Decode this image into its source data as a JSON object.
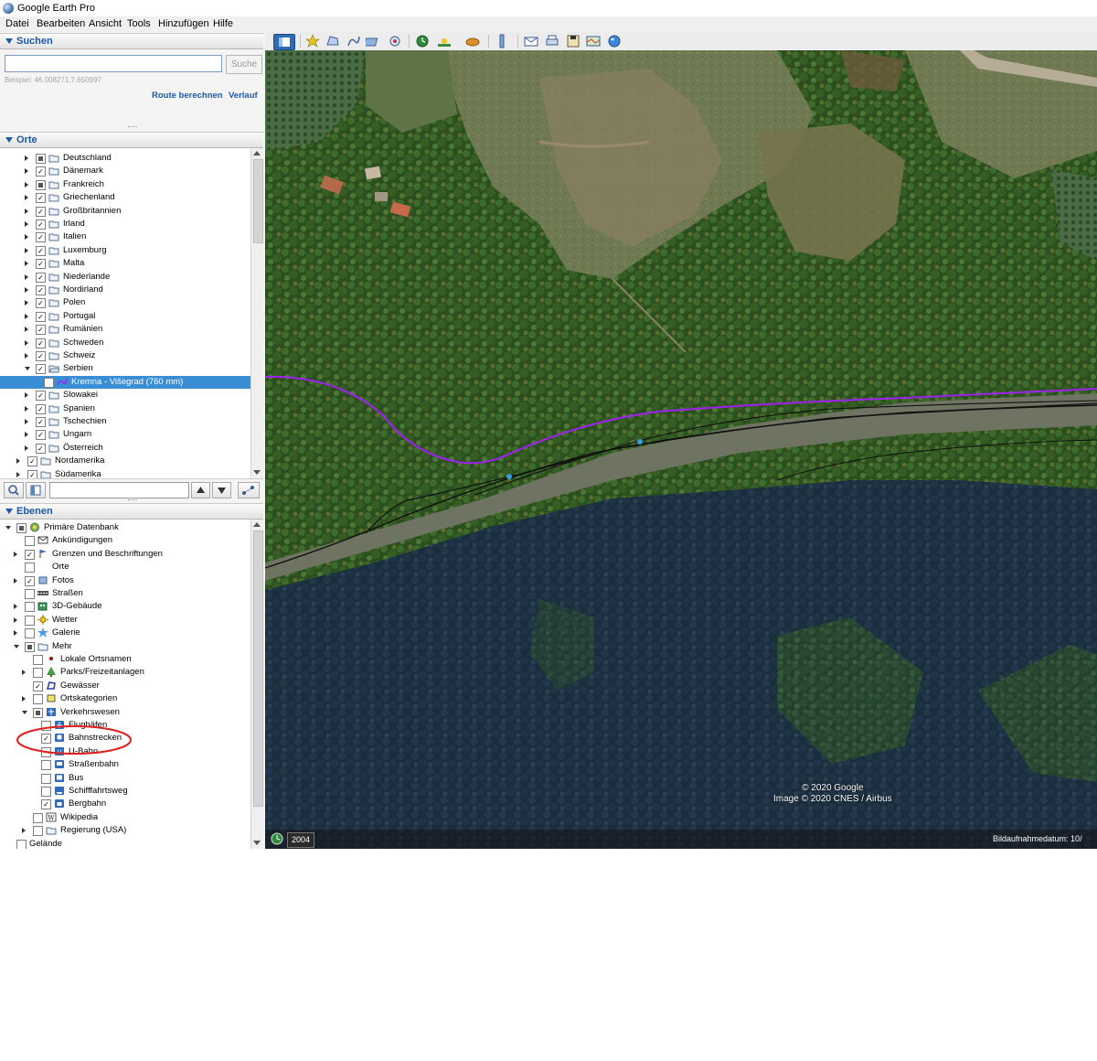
{
  "window": {
    "title": "Google Earth Pro"
  },
  "menu": [
    "Datei",
    "Bearbeiten",
    "Ansicht",
    "Tools",
    "Hinzufügen",
    "Hilfe"
  ],
  "search": {
    "header": "Suchen",
    "input_value": "",
    "button": "Suche",
    "example": "Beispiel: 46.008271,7.650997",
    "route_link": "Route berechnen",
    "history_link": "Verlauf"
  },
  "places": {
    "header": "Orte",
    "items": [
      {
        "label": "Deutschland",
        "depth": 3,
        "checked": "partial",
        "expanded": false,
        "icon": "folder-icon"
      },
      {
        "label": "Dänemark",
        "depth": 3,
        "checked": true,
        "expanded": false,
        "icon": "folder-icon"
      },
      {
        "label": "Frankreich",
        "depth": 3,
        "checked": "partial",
        "expanded": false,
        "icon": "folder-icon"
      },
      {
        "label": "Griechenland",
        "depth": 3,
        "checked": true,
        "expanded": false,
        "icon": "folder-icon"
      },
      {
        "label": "Großbritannien",
        "depth": 3,
        "checked": true,
        "expanded": false,
        "icon": "folder-icon"
      },
      {
        "label": "Irland",
        "depth": 3,
        "checked": true,
        "expanded": false,
        "icon": "folder-icon"
      },
      {
        "label": "Italien",
        "depth": 3,
        "checked": true,
        "expanded": false,
        "icon": "folder-icon"
      },
      {
        "label": "Luxemburg",
        "depth": 3,
        "checked": true,
        "expanded": false,
        "icon": "folder-icon"
      },
      {
        "label": "Malta",
        "depth": 3,
        "checked": true,
        "expanded": false,
        "icon": "folder-icon"
      },
      {
        "label": "Niederlande",
        "depth": 3,
        "checked": true,
        "expanded": false,
        "icon": "folder-icon"
      },
      {
        "label": "Nordirland",
        "depth": 3,
        "checked": true,
        "expanded": false,
        "icon": "folder-icon"
      },
      {
        "label": "Polen",
        "depth": 3,
        "checked": true,
        "expanded": false,
        "icon": "folder-icon"
      },
      {
        "label": "Portugal",
        "depth": 3,
        "checked": true,
        "expanded": false,
        "icon": "folder-icon"
      },
      {
        "label": "Rumänien",
        "depth": 3,
        "checked": true,
        "expanded": false,
        "icon": "folder-icon"
      },
      {
        "label": "Schweden",
        "depth": 3,
        "checked": true,
        "expanded": false,
        "icon": "folder-icon"
      },
      {
        "label": "Schweiz",
        "depth": 3,
        "checked": true,
        "expanded": false,
        "icon": "folder-icon"
      },
      {
        "label": "Serbien",
        "depth": 3,
        "checked": true,
        "expanded": true,
        "icon": "folder-open-icon"
      },
      {
        "label": "Kremna - Višegrad (760 mm)",
        "depth": 4,
        "checked": true,
        "expanded": null,
        "icon": "path-icon",
        "selected": true
      },
      {
        "label": "Slowakei",
        "depth": 3,
        "checked": true,
        "expanded": false,
        "icon": "folder-icon"
      },
      {
        "label": "Spanien",
        "depth": 3,
        "checked": true,
        "expanded": false,
        "icon": "folder-icon"
      },
      {
        "label": "Tschechien",
        "depth": 3,
        "checked": true,
        "expanded": false,
        "icon": "folder-icon"
      },
      {
        "label": "Ungarn",
        "depth": 3,
        "checked": true,
        "expanded": false,
        "icon": "folder-icon"
      },
      {
        "label": "Österreich",
        "depth": 3,
        "checked": true,
        "expanded": false,
        "icon": "folder-icon"
      },
      {
        "label": "Nordamerika",
        "depth": 2,
        "checked": true,
        "expanded": false,
        "icon": "folder-icon"
      },
      {
        "label": "Südamerika",
        "depth": 2,
        "checked": true,
        "expanded": false,
        "icon": "folder-icon"
      }
    ]
  },
  "layers": {
    "header": "Ebenen",
    "items": [
      {
        "label": "Primäre Datenbank",
        "depth": 0,
        "checked": "partial",
        "expanded": true,
        "icon": "database-icon"
      },
      {
        "label": "Ankündigungen",
        "depth": 1,
        "checked": false,
        "expanded": null,
        "icon": "envelope-icon"
      },
      {
        "label": "Grenzen und Beschriftungen",
        "depth": 1,
        "checked": true,
        "expanded": false,
        "icon": "flag-icon"
      },
      {
        "label": "Orte",
        "depth": 1,
        "checked": false,
        "expanded": null,
        "icon": "place-icon"
      },
      {
        "label": "Fotos",
        "depth": 1,
        "checked": true,
        "expanded": false,
        "icon": "photo-icon"
      },
      {
        "label": "Straßen",
        "depth": 1,
        "checked": false,
        "expanded": null,
        "icon": "road-icon"
      },
      {
        "label": "3D-Gebäude",
        "depth": 1,
        "checked": false,
        "expanded": false,
        "icon": "building-icon"
      },
      {
        "label": "Wetter",
        "depth": 1,
        "checked": false,
        "expanded": false,
        "icon": "sun-icon"
      },
      {
        "label": "Galerie",
        "depth": 1,
        "checked": false,
        "expanded": false,
        "icon": "star-icon"
      },
      {
        "label": "Mehr",
        "depth": 1,
        "checked": "partial",
        "expanded": true,
        "icon": "folder-icon"
      },
      {
        "label": "Lokale Ortsnamen",
        "depth": 2,
        "checked": false,
        "expanded": null,
        "icon": "dot-icon"
      },
      {
        "label": "Parks/Freizeitanlagen",
        "depth": 2,
        "checked": false,
        "expanded": false,
        "icon": "tree-icon"
      },
      {
        "label": "Gewässer",
        "depth": 2,
        "checked": true,
        "expanded": null,
        "icon": "water-icon"
      },
      {
        "label": "Ortskategorien",
        "depth": 2,
        "checked": false,
        "expanded": false,
        "icon": "category-icon"
      },
      {
        "label": "Verkehrswesen",
        "depth": 2,
        "checked": "partial",
        "expanded": true,
        "icon": "transport-icon"
      },
      {
        "label": "Flughäfen",
        "depth": 3,
        "checked": false,
        "expanded": null,
        "icon": "airport-icon"
      },
      {
        "label": "Bahnstrecken",
        "depth": 3,
        "checked": true,
        "expanded": null,
        "icon": "train-icon"
      },
      {
        "label": "U-Bahn",
        "depth": 3,
        "checked": false,
        "expanded": null,
        "icon": "subway-icon"
      },
      {
        "label": "Straßenbahn",
        "depth": 3,
        "checked": false,
        "expanded": null,
        "icon": "tram-icon"
      },
      {
        "label": "Bus",
        "depth": 3,
        "checked": false,
        "expanded": null,
        "icon": "bus-icon"
      },
      {
        "label": "Schifffahrtsweg",
        "depth": 3,
        "checked": false,
        "expanded": null,
        "icon": "ferry-icon"
      },
      {
        "label": "Bergbahn",
        "depth": 3,
        "checked": true,
        "expanded": null,
        "icon": "cablecar-icon"
      },
      {
        "label": "Wikipedia",
        "depth": 2,
        "checked": false,
        "expanded": null,
        "icon": "wikipedia-icon"
      },
      {
        "label": "Regierung (USA)",
        "depth": 2,
        "checked": false,
        "expanded": false,
        "icon": "folder-icon"
      },
      {
        "label": "Gelände",
        "depth": 0,
        "checked": false,
        "expanded": null,
        "icon": ""
      }
    ]
  },
  "map": {
    "copyright_line1": "© 2020 Google",
    "copyright_line2": "Image © 2020 CNES / Airbus",
    "historical_year": "2004",
    "imagery_date": "Bildaufnahmedatum: 10/"
  },
  "colors": {
    "accent": "#1c5aa6",
    "selection": "#3a8ed6",
    "track_purple": "#a020f0",
    "track_black": "#101010",
    "highlight_ellipse": "#e0201e"
  }
}
